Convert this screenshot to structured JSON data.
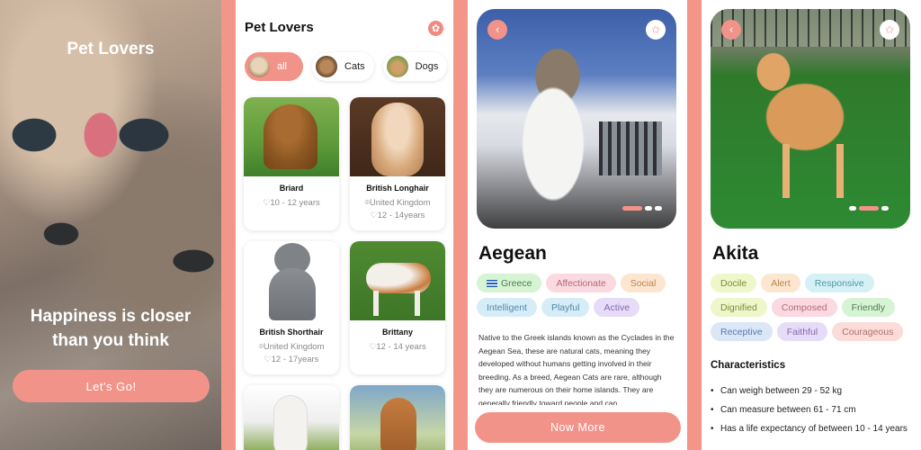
{
  "splash": {
    "title": "Pet Lovers",
    "tagline_line1": "Happiness is closer",
    "tagline_line2": "than you think",
    "button": "Let's Go!"
  },
  "list": {
    "title": "Pet Lovers",
    "favorite_icon": "heart-star-icon",
    "filters": [
      {
        "label": "all",
        "active": true
      },
      {
        "label": "Cats",
        "active": false
      },
      {
        "label": "Dogs",
        "active": false
      }
    ],
    "cards": [
      {
        "name": "Briard",
        "origin": "",
        "lifespan": "10 - 12 years"
      },
      {
        "name": "British Longhair",
        "origin": "United Kingdom",
        "lifespan": "12 - 14years"
      },
      {
        "name": "British Shorthair",
        "origin": "United Kingdom",
        "lifespan": "12 - 17years"
      },
      {
        "name": "Brittany",
        "origin": "",
        "lifespan": "12 - 14 years"
      }
    ]
  },
  "aegean": {
    "name": "Aegean",
    "tags": [
      "Greece",
      "Affectionate",
      "Social",
      "Intelligent",
      "Playful",
      "Active"
    ],
    "description": "Native to the Greek islands known as the Cyclades in the Aegean Sea, these are natural cats, meaning they developed without humans getting involved in their breeding. As a breed, Aegean Cats are rare, although they are numerous on their home islands. They are generally friendly toward people and can",
    "button": "Now More"
  },
  "akita": {
    "name": "Akita",
    "tags": [
      "Docile",
      "Alert",
      "Responsive",
      "Dignified",
      "Composed",
      "Friendly",
      "Receptive",
      "Faithful",
      "Courageous"
    ],
    "characteristics_title": "Characteristics",
    "characteristics": [
      "Can weigh between 29 - 52 kg",
      "Can measure between 61 - 71 cm",
      "Has a life expectancy of between 10 - 14 years"
    ]
  },
  "colors": {
    "accent": "#f2938a",
    "border": "#f4958a"
  }
}
